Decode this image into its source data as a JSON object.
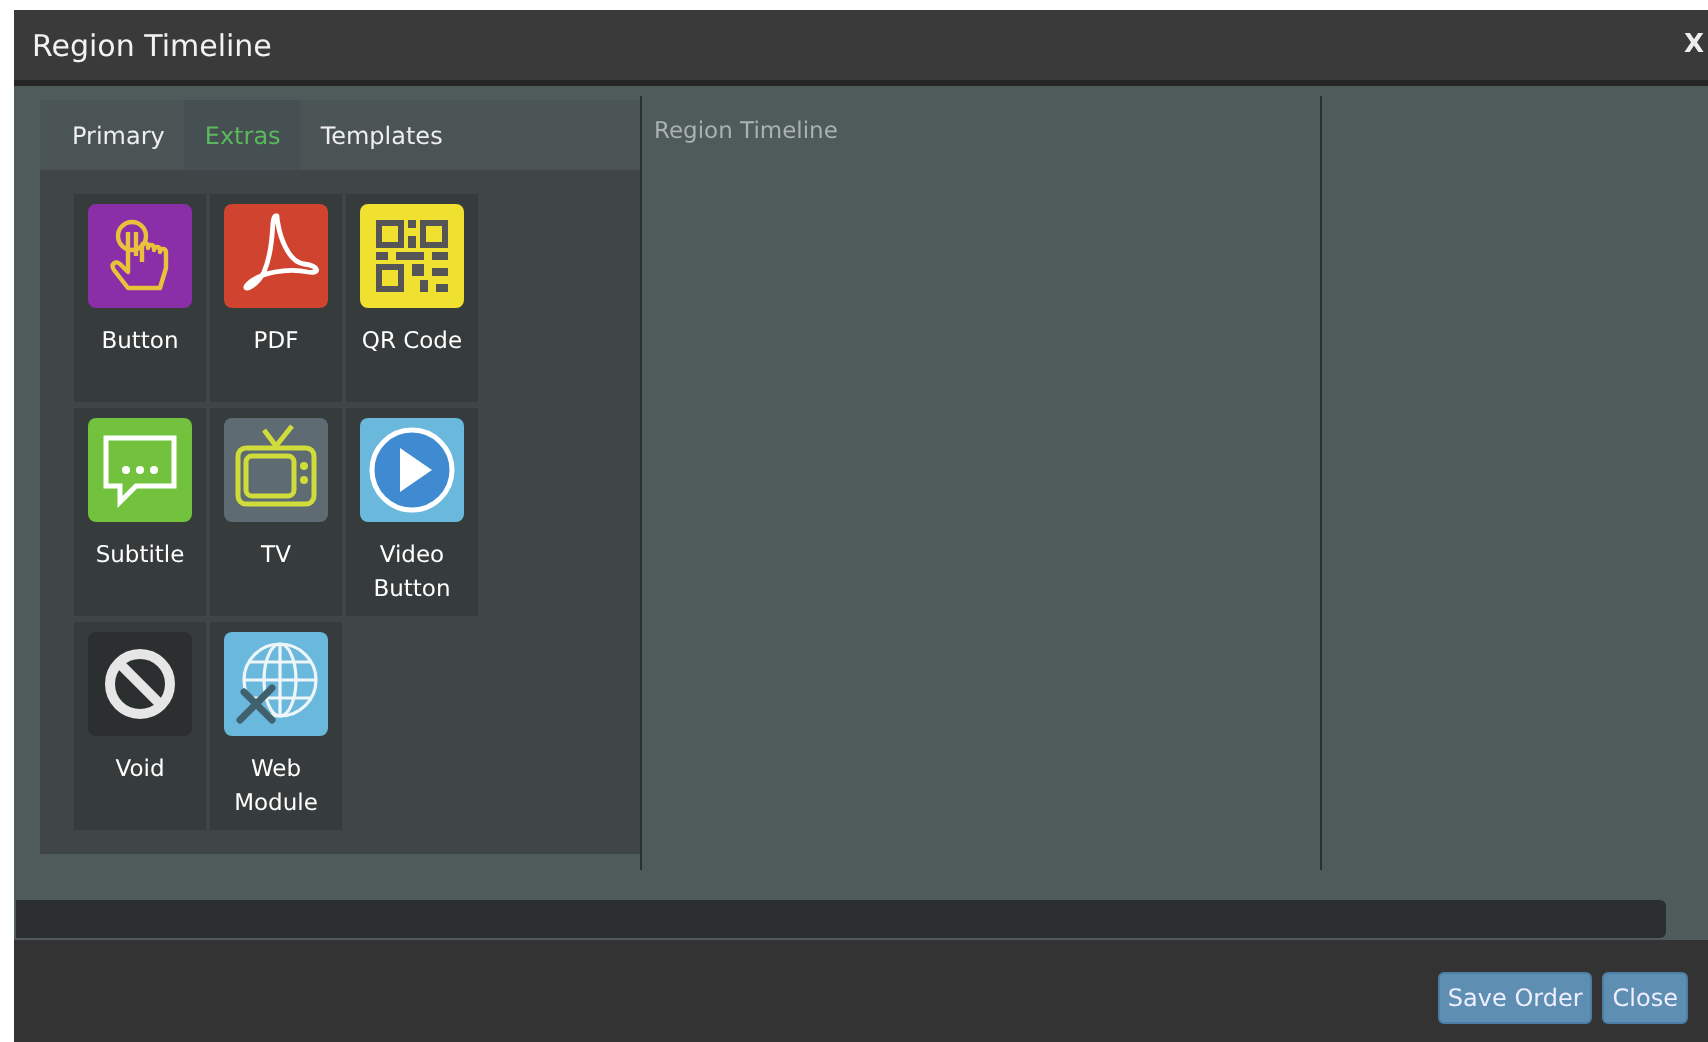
{
  "window": {
    "title": "Region Timeline",
    "close": "X"
  },
  "tabs": [
    {
      "label": "Primary",
      "selected": false
    },
    {
      "label": "Extras",
      "selected": true
    },
    {
      "label": "Templates",
      "selected": false
    }
  ],
  "modules": [
    {
      "label": "Button",
      "kind": "button"
    },
    {
      "label": "PDF",
      "kind": "pdf"
    },
    {
      "label": "QR Code",
      "kind": "qr"
    },
    {
      "label": "Subtitle",
      "kind": "subtitle"
    },
    {
      "label": "TV",
      "kind": "tv"
    },
    {
      "label": "Video Button",
      "kind": "video"
    },
    {
      "label": "Void",
      "kind": "void"
    },
    {
      "label": "Web Module",
      "kind": "web"
    }
  ],
  "timeline": {
    "title": "Region Timeline"
  },
  "buttons": [
    "Save Order",
    "Close"
  ]
}
